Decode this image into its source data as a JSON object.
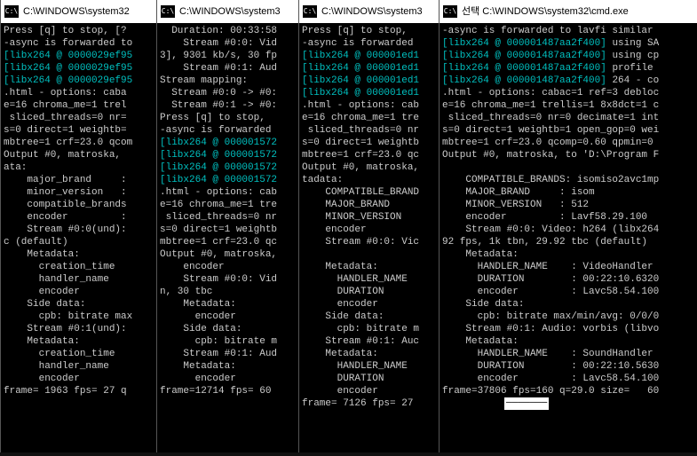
{
  "windows": [
    {
      "title": "C:\\WINDOWS\\system32",
      "icon": "C:\\",
      "lines": [
        {
          "t": "Press [q] to stop, [?"
        },
        {
          "t": "-async is forwarded to"
        },
        {
          "t": "[libx264 @ 0000029ef95",
          "c": "libx"
        },
        {
          "t": "[libx264 @ 0000029ef95",
          "c": "libx"
        },
        {
          "t": "[libx264 @ 0000029ef95",
          "c": "libx"
        },
        {
          "t": ".html - options: caba"
        },
        {
          "t": "e=16 chroma_me=1 trel"
        },
        {
          "t": " sliced_threads=0 nr="
        },
        {
          "t": "s=0 direct=1 weightb="
        },
        {
          "t": "mbtree=1 crf=23.0 qcom"
        },
        {
          "t": "Output #0, matroska,"
        },
        {
          "t": "ata:"
        },
        {
          "t": "    major_brand     :"
        },
        {
          "t": "    minor_version   :"
        },
        {
          "t": "    compatible_brands"
        },
        {
          "t": "    encoder         :"
        },
        {
          "t": "    Stream #0:0(und):"
        },
        {
          "t": "c (default)"
        },
        {
          "t": "    Metadata:"
        },
        {
          "t": "      creation_time"
        },
        {
          "t": "      handler_name"
        },
        {
          "t": "      encoder"
        },
        {
          "t": "    Side data:"
        },
        {
          "t": "      cpb: bitrate max"
        },
        {
          "t": "    Stream #0:1(und):"
        },
        {
          "t": "    Metadata:"
        },
        {
          "t": "      creation_time"
        },
        {
          "t": "      handler_name"
        },
        {
          "t": "      encoder"
        },
        {
          "t": "frame= 1963 fps= 27 q"
        }
      ]
    },
    {
      "title": "C:\\WINDOWS\\system3",
      "icon": "C:\\",
      "lines": [
        {
          "t": "  Duration: 00:33:58"
        },
        {
          "t": "    Stream #0:0: Vid"
        },
        {
          "t": "3], 9301 kb/s, 30 fp"
        },
        {
          "t": "    Stream #0:1: Aud"
        },
        {
          "t": "Stream mapping:"
        },
        {
          "t": "  Stream #0:0 -> #0:"
        },
        {
          "t": "  Stream #0:1 -> #0:"
        },
        {
          "t": "Press [q] to stop,"
        },
        {
          "t": "-async is forwarded"
        },
        {
          "t": "[libx264 @ 000001572",
          "c": "libx"
        },
        {
          "t": "[libx264 @ 000001572",
          "c": "libx"
        },
        {
          "t": "[libx264 @ 000001572",
          "c": "libx"
        },
        {
          "t": "[libx264 @ 000001572",
          "c": "libx"
        },
        {
          "t": ".html - options: cab"
        },
        {
          "t": "e=16 chroma_me=1 tre"
        },
        {
          "t": " sliced_threads=0 nr"
        },
        {
          "t": "s=0 direct=1 weightb"
        },
        {
          "t": "mbtree=1 crf=23.0 qc"
        },
        {
          "t": "Output #0, matroska,"
        },
        {
          "t": "    encoder"
        },
        {
          "t": "    Stream #0:0: Vid"
        },
        {
          "t": "n, 30 tbc"
        },
        {
          "t": "    Metadata:"
        },
        {
          "t": "      encoder"
        },
        {
          "t": "    Side data:"
        },
        {
          "t": "      cpb: bitrate m"
        },
        {
          "t": "    Stream #0:1: Aud"
        },
        {
          "t": "    Metadata:"
        },
        {
          "t": "      encoder"
        },
        {
          "t": "frame=12714 fps= 60"
        }
      ]
    },
    {
      "title": "C:\\WINDOWS\\system3",
      "icon": "C:\\",
      "lines": [
        {
          "t": "Press [q] to stop,"
        },
        {
          "t": "-async is forwarded"
        },
        {
          "t": "[libx264 @ 000001ed1",
          "c": "libx"
        },
        {
          "t": "[libx264 @ 000001ed1",
          "c": "libx"
        },
        {
          "t": "[libx264 @ 000001ed1",
          "c": "libx"
        },
        {
          "t": "[libx264 @ 000001ed1",
          "c": "libx"
        },
        {
          "t": ".html - options: cab"
        },
        {
          "t": "e=16 chroma_me=1 tre"
        },
        {
          "t": " sliced_threads=0 nr"
        },
        {
          "t": "s=0 direct=1 weightb"
        },
        {
          "t": "mbtree=1 crf=23.0 qc"
        },
        {
          "t": "Output #0, matroska,"
        },
        {
          "t": "tadata:"
        },
        {
          "t": "    COMPATIBLE_BRAND"
        },
        {
          "t": "    MAJOR_BRAND"
        },
        {
          "t": "    MINOR_VERSION"
        },
        {
          "t": "    encoder"
        },
        {
          "t": "    Stream #0:0: Vic"
        },
        {
          "t": ""
        },
        {
          "t": "    Metadata:"
        },
        {
          "t": "      HANDLER_NAME"
        },
        {
          "t": "      DURATION"
        },
        {
          "t": "      encoder"
        },
        {
          "t": "    Side data:"
        },
        {
          "t": "      cpb: bitrate m"
        },
        {
          "t": "    Stream #0:1: Auc"
        },
        {
          "t": "    Metadata:"
        },
        {
          "t": "      HANDLER_NAME"
        },
        {
          "t": "      DURATION"
        },
        {
          "t": "      encoder"
        },
        {
          "t": "frame= 7126 fps= 27 "
        }
      ]
    },
    {
      "title": "선택 C:\\WINDOWS\\system32\\cmd.exe",
      "icon": "C:\\",
      "lines": [
        {
          "t": "-async is forwarded to lavfi similar"
        },
        {
          "t": "[libx264 @ 000001487aa2f400] ",
          "c": "libx",
          "suffix": "using SA"
        },
        {
          "t": "[libx264 @ 000001487aa2f400] ",
          "c": "libx",
          "suffix": "using cp"
        },
        {
          "t": "[libx264 @ 000001487aa2f400] ",
          "c": "libx",
          "suffix": "profile"
        },
        {
          "t": "[libx264 @ 000001487aa2f400] ",
          "c": "libx",
          "suffix": "264 - co"
        },
        {
          "t": ".html - options: cabac=1 ref=3 debloc"
        },
        {
          "t": "e=16 chroma_me=1 trellis=1 8x8dct=1 c"
        },
        {
          "t": " sliced_threads=0 nr=0 decimate=1 int"
        },
        {
          "t": "s=0 direct=1 weightb=1 open_gop=0 wei"
        },
        {
          "t": "mbtree=1 crf=23.0 qcomp=0.60 qpmin=0"
        },
        {
          "t": "Output #0, matroska, to 'D:\\Program F"
        },
        {
          "t": ""
        },
        {
          "t": "    COMPATIBLE_BRANDS: isomiso2avc1mp"
        },
        {
          "t": "    MAJOR_BRAND     : isom"
        },
        {
          "t": "    MINOR_VERSION   : 512"
        },
        {
          "t": "    encoder         : Lavf58.29.100"
        },
        {
          "t": "    Stream #0:0: Video: h264 (libx264"
        },
        {
          "t": "92 fps, 1k tbn, 29.92 tbc (default)"
        },
        {
          "t": "    Metadata:"
        },
        {
          "t": "      HANDLER_NAME    : VideoHandler"
        },
        {
          "t": "      DURATION        : 00:22:10.6320"
        },
        {
          "t": "      encoder         : Lavc58.54.100"
        },
        {
          "t": "    Side data:"
        },
        {
          "t": "      cpb: bitrate max/min/avg: 0/0/0"
        },
        {
          "t": "    Stream #0:1: Audio: vorbis (libvo"
        },
        {
          "t": "    Metadata:"
        },
        {
          "t": "      HANDLER_NAME    : SoundHandler"
        },
        {
          "t": "      DURATION        : 00:22:10.5630"
        },
        {
          "t": "      encoder         : Lavc58.54.100"
        },
        {
          "t": "frame=37806 fps=160 q=29.0 size=   60"
        }
      ],
      "highlight": "───────"
    }
  ]
}
